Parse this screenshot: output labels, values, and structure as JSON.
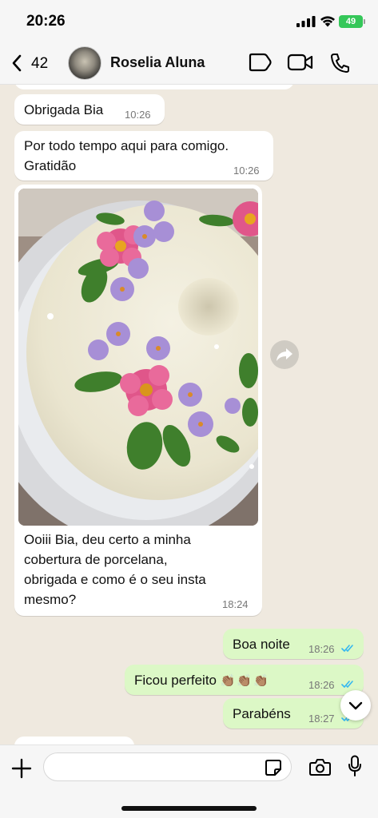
{
  "status_bar": {
    "time": "20:26",
    "battery": "49"
  },
  "header": {
    "back_count": "42",
    "contact_name": "Roselia Aluna"
  },
  "messages": [
    {
      "direction": "in",
      "text": "Obrigada Bia",
      "time": "10:26"
    },
    {
      "direction": "in",
      "text_lines": [
        "Por todo tempo aqui para comigo.",
        "Gratidão"
      ],
      "time": "10:26"
    },
    {
      "direction": "in",
      "type": "image",
      "image_subject": "cake-with-painted-flowers",
      "caption_lines": [
        "Ooiii Bia, deu certo a minha",
        "cobertura de porcelana,",
        "obrigada e como é o seu insta",
        "mesmo?"
      ],
      "time": "18:24"
    },
    {
      "direction": "out",
      "text": "Boa noite",
      "time": "18:26",
      "status": "read"
    },
    {
      "direction": "out",
      "text": "Ficou perfeito",
      "emoji": "👏🏽👏🏽👏🏽",
      "time": "18:26",
      "status": "read"
    },
    {
      "direction": "out",
      "text": "Parabéns",
      "time": "18:27",
      "status": "read"
    }
  ],
  "colors": {
    "chat_bg": "#efe9df",
    "incoming": "#ffffff",
    "outgoing": "#dcf8c6",
    "read_ticks": "#34b7f1",
    "battery": "#35c759"
  },
  "icons": {
    "back": "chevron-left-icon",
    "tag": "label-icon",
    "video": "video-camera-icon",
    "call": "phone-icon",
    "forward": "share-arrow-icon",
    "scroll": "chevron-down-icon",
    "plus": "plus-icon",
    "sticker": "sticker-icon",
    "camera": "camera-icon",
    "mic": "microphone-icon"
  },
  "input": {
    "value": ""
  }
}
